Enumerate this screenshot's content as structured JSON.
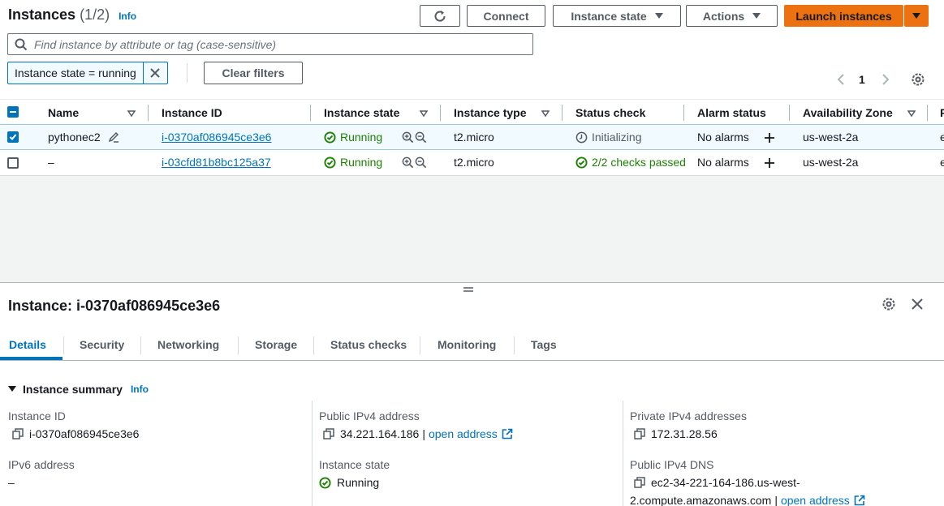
{
  "header": {
    "title": "Instances",
    "count": "(1/2)",
    "info": "Info",
    "buttons": {
      "refresh_icon": "refresh-icon",
      "connect": "Connect",
      "instance_state": "Instance state",
      "actions": "Actions",
      "launch": "Launch instances"
    },
    "colors": {
      "primary": "#ec7211",
      "link": "#0073bb",
      "success": "#1d8102"
    }
  },
  "search": {
    "placeholder": "Find instance by attribute or tag (case-sensitive)"
  },
  "filter_chip": {
    "label": "Instance state = running"
  },
  "clear_filters": "Clear filters",
  "pagination": {
    "page": "1"
  },
  "table": {
    "columns": [
      "Name",
      "Instance ID",
      "Instance state",
      "Instance type",
      "Status check",
      "Alarm status",
      "Availability Zone"
    ],
    "rows": [
      {
        "selected": true,
        "name": "pythonec2",
        "instance_id": "i-0370af086945ce3e6",
        "state": "Running",
        "type": "t2.micro",
        "status": "Initializing",
        "alarm": "No alarms",
        "az": "us-west-2a",
        "overflow": "e"
      },
      {
        "selected": false,
        "name": "–",
        "instance_id": "i-03cfd81b8bc125a37",
        "state": "Running",
        "type": "t2.micro",
        "status": "2/2 checks passed",
        "alarm": "No alarms",
        "az": "us-west-2a",
        "overflow": "e"
      }
    ]
  },
  "details": {
    "title": "Instance: i-0370af086945ce3e6",
    "tabs": [
      "Details",
      "Security",
      "Networking",
      "Storage",
      "Status checks",
      "Monitoring",
      "Tags"
    ],
    "section": "Instance summary",
    "section_info": "Info",
    "fields": {
      "instance_id_label": "Instance ID",
      "instance_id": "i-0370af086945ce3e6",
      "ipv6_label": "IPv6 address",
      "ipv6": "–",
      "public_ipv4_label": "Public IPv4 address",
      "public_ipv4": "34.221.164.186",
      "open_address": "open address",
      "state_label": "Instance state",
      "state": "Running",
      "private_ipv4_label": "Private IPv4 addresses",
      "private_ipv4": "172.31.28.56",
      "public_dns_label": "Public IPv4 DNS",
      "public_dns_line1": "ec2-34-221-164-186.us-west-",
      "public_dns_line2": "2.compute.amazonaws.com",
      "separator": "|"
    }
  }
}
